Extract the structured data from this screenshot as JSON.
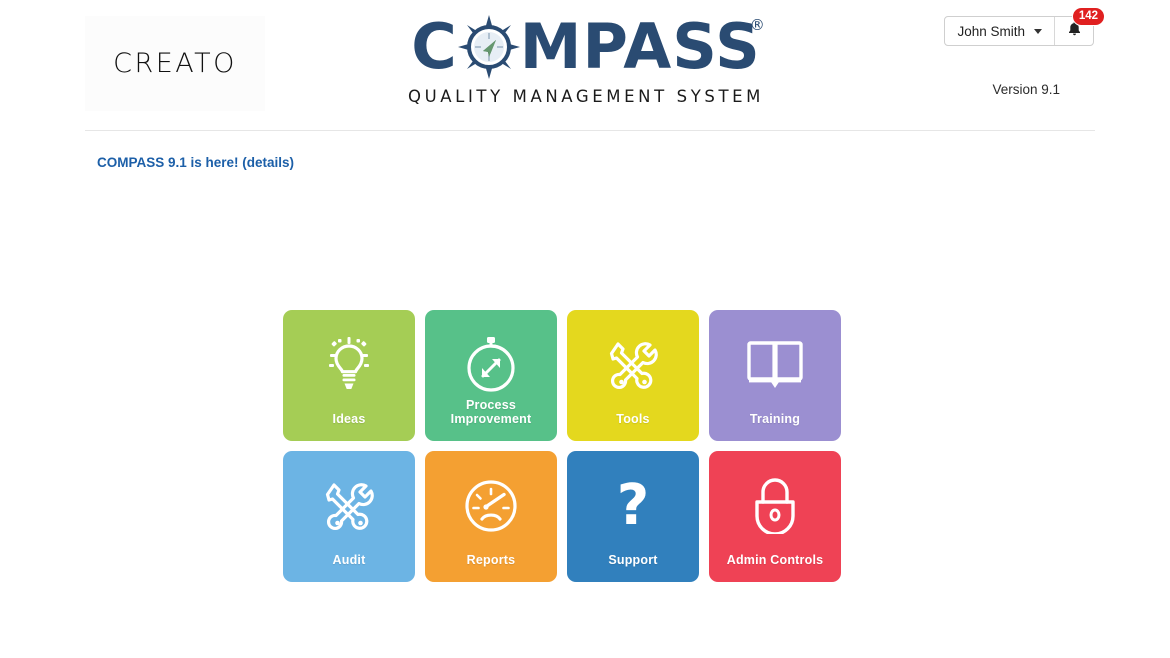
{
  "brand": {
    "name": "CREATO"
  },
  "logo": {
    "word_before": "C",
    "word_after": "MPASS",
    "registered": "®",
    "subtitle": "QUALITY MANAGEMENT SYSTEM",
    "color": "#2a4b72",
    "rose_icon": "compass-rose-icon"
  },
  "header": {
    "user_name": "John Smith",
    "user_caret_icon": "chevron-down-icon",
    "bell_icon": "bell-icon",
    "notification_count": "142",
    "version": "Version 9.1"
  },
  "announcement": {
    "text": "COMPASS 9.1 is here! (details)",
    "color": "#1c5fa8"
  },
  "tiles": [
    {
      "label": "Ideas",
      "color": "#a5cd55",
      "icon": "lightbulb-icon"
    },
    {
      "label": "Process Improvement",
      "color": "#57c189",
      "icon": "stopwatch-arrow-icon"
    },
    {
      "label": "Tools",
      "color": "#e4d81e",
      "icon": "tools-icon"
    },
    {
      "label": "Training",
      "color": "#9b8fd1",
      "icon": "open-book-icon"
    },
    {
      "label": "Audit",
      "color": "#6cb4e4",
      "icon": "tools-icon"
    },
    {
      "label": "Reports",
      "color": "#f4a032",
      "icon": "gauge-icon"
    },
    {
      "label": "Support",
      "color": "#3180bd",
      "icon": "question-mark-icon"
    },
    {
      "label": "Admin Controls",
      "color": "#ef4255",
      "icon": "padlock-icon"
    }
  ]
}
